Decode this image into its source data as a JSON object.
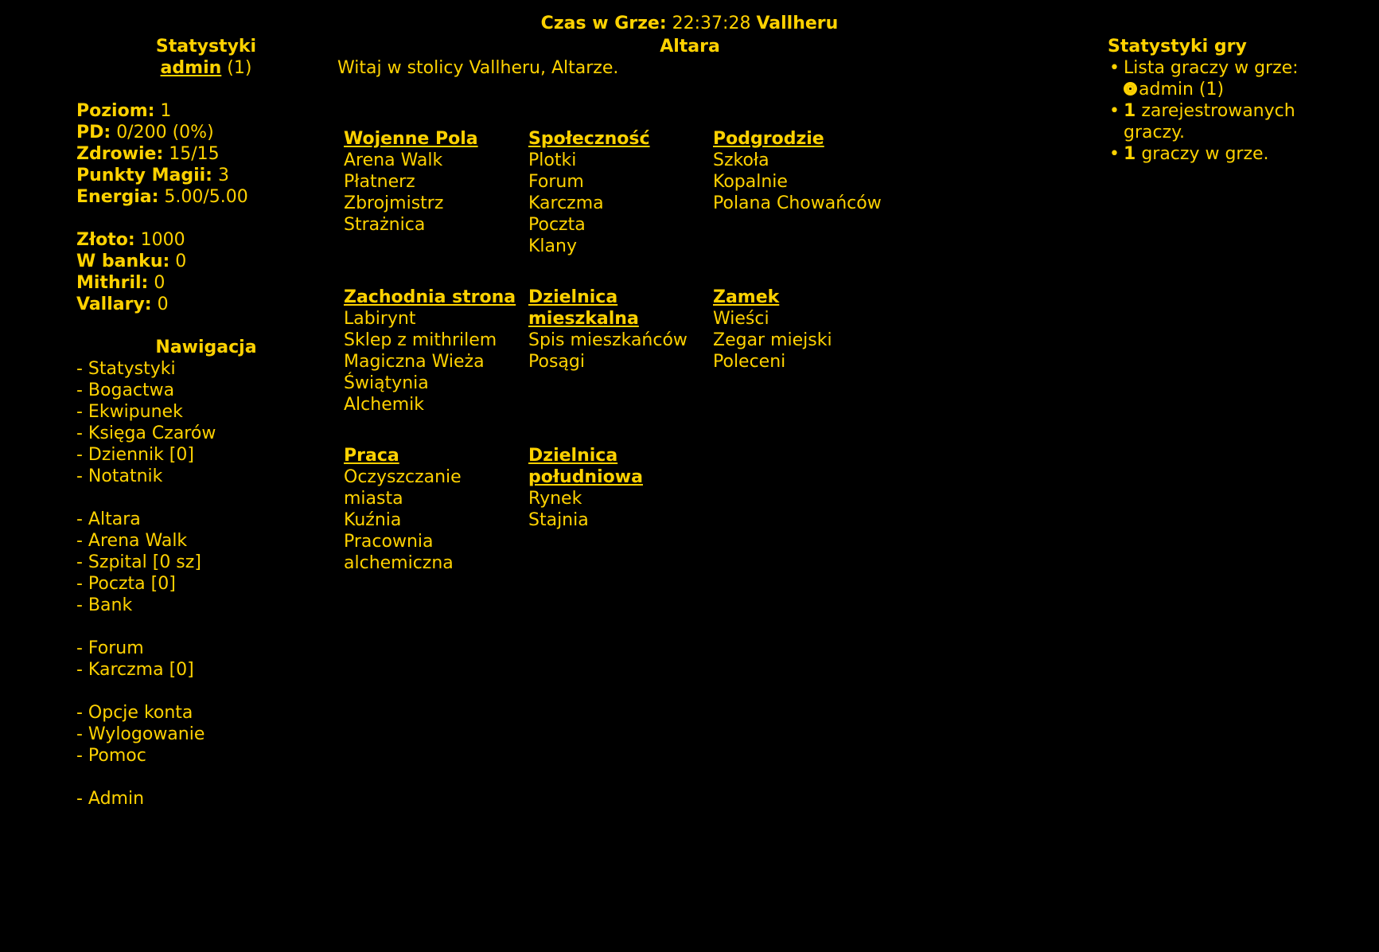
{
  "topbar": {
    "time_label": "Czas w Grze:",
    "time_value": "22:37:28",
    "world": "Vallheru"
  },
  "left": {
    "stats_title": "Statystyki",
    "player_name": "admin",
    "player_id": "(1)",
    "stats": [
      {
        "label": "Poziom:",
        "value": "1"
      },
      {
        "label": "PD:",
        "value": "0/200 (0%)"
      },
      {
        "label": "Zdrowie:",
        "value": "15/15"
      },
      {
        "label": "Punkty Magii:",
        "value": "3"
      },
      {
        "label": "Energia:",
        "value": "5.00/5.00"
      }
    ],
    "wealth": [
      {
        "label": "Złoto:",
        "value": "1000"
      },
      {
        "label": "W banku:",
        "value": "0"
      },
      {
        "label": "Mithril:",
        "value": "0"
      },
      {
        "label": "Vallary:",
        "value": "0"
      }
    ],
    "nav_title": "Nawigacja",
    "nav_groups": [
      [
        "- Statystyki",
        "- Bogactwa",
        "- Ekwipunek",
        "- Księga Czarów",
        "- Dziennik [0]",
        "- Notatnik"
      ],
      [
        "- Altara",
        "- Arena Walk",
        "- Szpital [0 sz]",
        "- Poczta [0]",
        "- Bank"
      ],
      [
        "- Forum",
        "- Karczma [0]"
      ],
      [
        "- Opcje konta",
        "- Wylogowanie",
        "- Pomoc"
      ],
      [
        "- Admin"
      ]
    ]
  },
  "main": {
    "location": "Altara",
    "welcome": "Witaj w stolicy Vallheru, Altarze.",
    "districts": [
      {
        "head": [
          "Wojenne Pola"
        ],
        "items": [
          "Arena Walk",
          "Płatnerz",
          "Zbrojmistrz",
          "Strażnica"
        ]
      },
      {
        "head": [
          "Społeczność"
        ],
        "items": [
          "Plotki",
          "Forum",
          "Karczma",
          "Poczta",
          "Klany"
        ]
      },
      {
        "head": [
          "Podgrodzie"
        ],
        "items": [
          "Szkoła",
          "Kopalnie",
          "Polana Chowańców"
        ]
      },
      {
        "head": [
          "Zachodnia strona"
        ],
        "items": [
          "Labirynt",
          "Sklep z mithrilem",
          "Magiczna Wieża",
          "Świątynia",
          "Alchemik"
        ]
      },
      {
        "head": [
          "Dzielnica",
          "mieszkalna"
        ],
        "items": [
          "Spis mieszkańców",
          "Posągi"
        ]
      },
      {
        "head": [
          "Zamek"
        ],
        "items": [
          "Wieści",
          "Zegar miejski",
          "Poleceni"
        ]
      },
      {
        "head": [
          "Praca"
        ],
        "items": [
          "Oczyszczanie",
          "miasta",
          "Kuźnia",
          "Pracownia",
          "alchemiczna"
        ]
      },
      {
        "head": [
          "Dzielnica",
          "południowa"
        ],
        "items": [
          "Rynek",
          "Stajnia"
        ]
      }
    ]
  },
  "right": {
    "title": "Statystyki gry",
    "players_list_label": "Lista graczy w grze:",
    "online_player": "admin (1)",
    "registered_count": "1",
    "registered_text": "zarejestrowanych",
    "registered_text2": "graczy.",
    "ingame_count": "1",
    "ingame_text": "graczy w grze.",
    "icons": {
      "player_status": "player-online-icon"
    }
  }
}
